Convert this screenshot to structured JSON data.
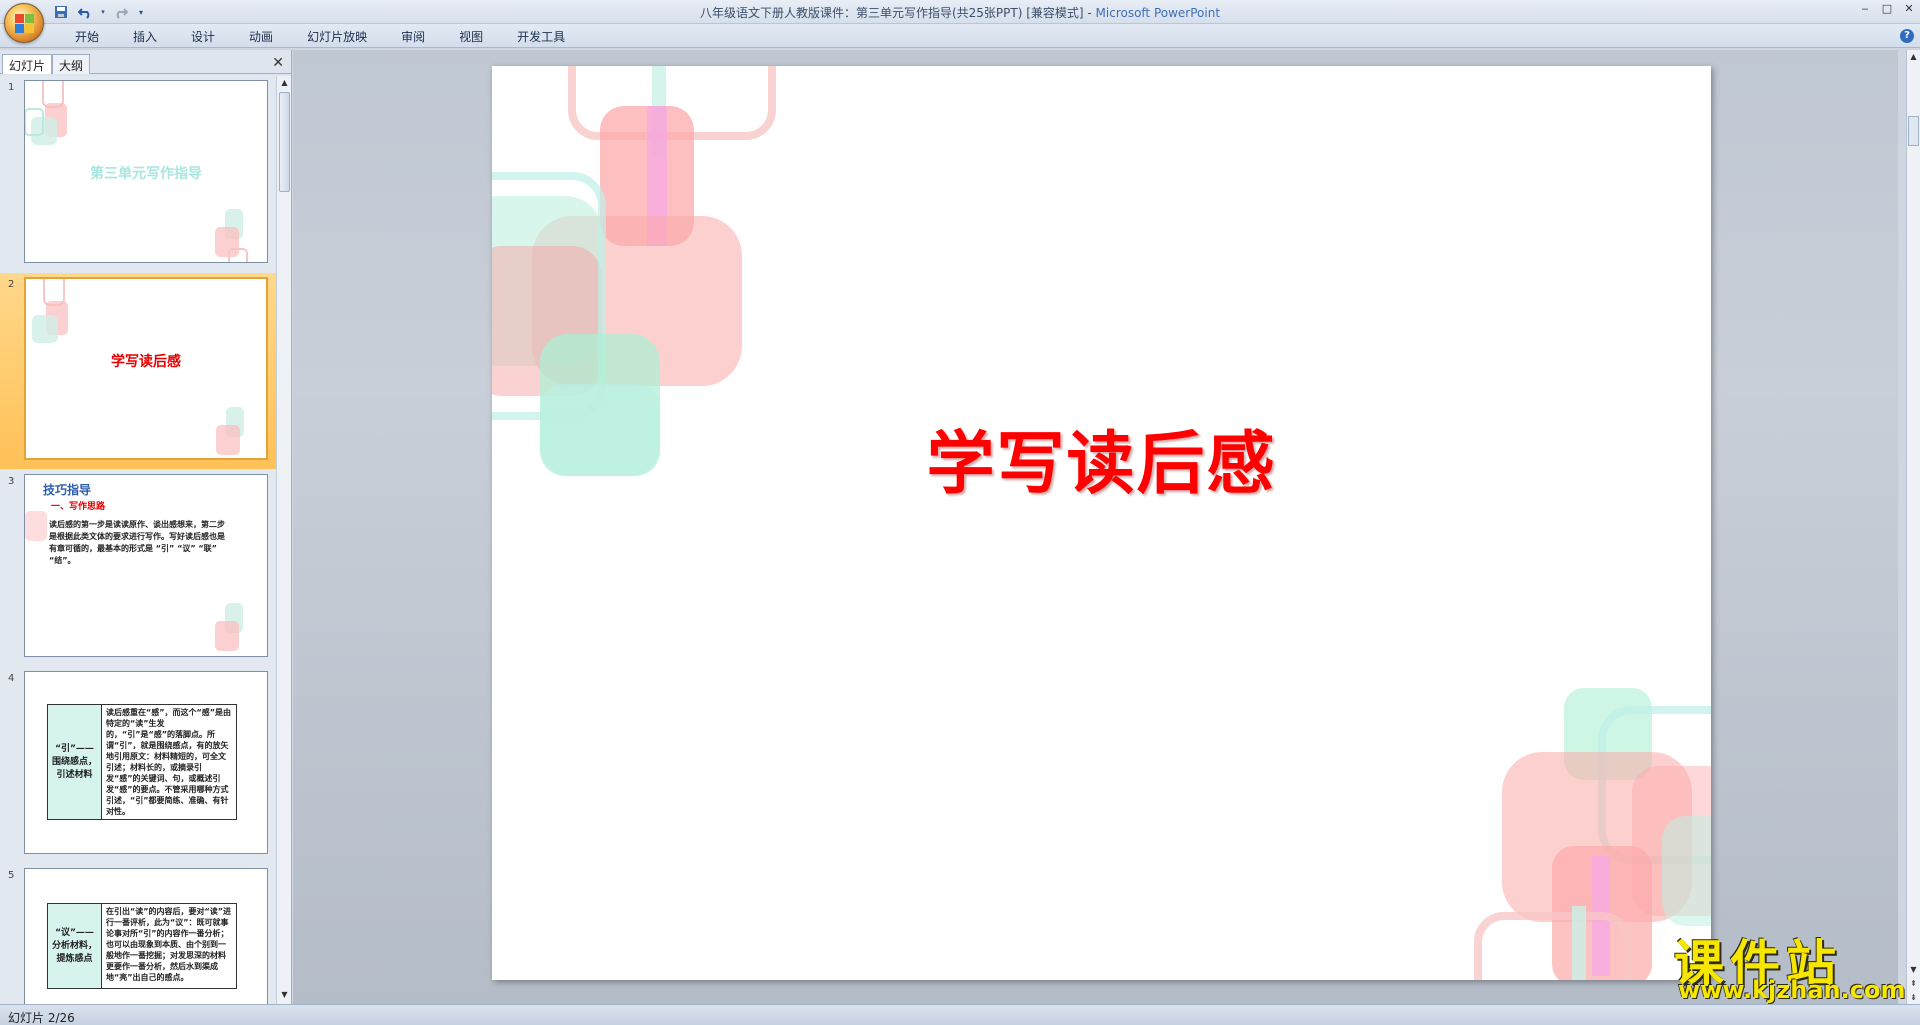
{
  "window": {
    "title": "八年级语文下册人教版课件：第三单元写作指导(共25张PPT) [兼容模式] - ",
    "app_name": "Microsoft PowerPoint",
    "controls": [
      "‒",
      "□",
      "✕"
    ]
  },
  "ribbon": {
    "tabs": [
      "开始",
      "插入",
      "设计",
      "动画",
      "幻灯片放映",
      "审阅",
      "视图",
      "开发工具"
    ]
  },
  "left_pane": {
    "tabs": [
      "幻灯片",
      "大纲"
    ],
    "close": "✕",
    "slides": [
      {
        "num": "1",
        "title": "第三单元写作指导"
      },
      {
        "num": "2",
        "title": "学写读后感"
      },
      {
        "num": "3",
        "heading": "技巧指导",
        "sub": "一、写作思路",
        "body": "读后感的第一步是读读原作、谈出感想来，第二步是根据此类文体的要求进行写作。写好读后感也是有章可循的，最基本的形式是 “引” “议” “联” “结”。"
      },
      {
        "num": "4",
        "label": "“引”——围绕感点，引述材料",
        "body": "读后感重在“感”，而这个“感”是由特定的“读”生发的，“引”是“感”的落脚点。所谓“引”，就是围绕感点，有的放矢地引用原文：材料精短的，可全文引述；材料长的，或摘录引发“感”的关键词、句，或概述引发“感”的要点。不管采用哪种方式引述，“引”都要简练、准确、有针对性。"
      },
      {
        "num": "5",
        "label": "“议”——分析材料，提炼感点",
        "body": "在引出“读”的内容后，要对“读”进行一番评析，此为“议”：既可就事论事对所“引”的内容作一番分析；也可以由现象到本质、由个别到一般地作一番挖掘；对发思深的材料更要作一番分析，然后水到渠成地“亮”出自己的感点。"
      }
    ]
  },
  "slide": {
    "title": "学写读后感"
  },
  "status": {
    "text": "幻灯片 2/26"
  },
  "watermark": {
    "text": "课件站",
    "url": "www.kjzhan.com"
  }
}
